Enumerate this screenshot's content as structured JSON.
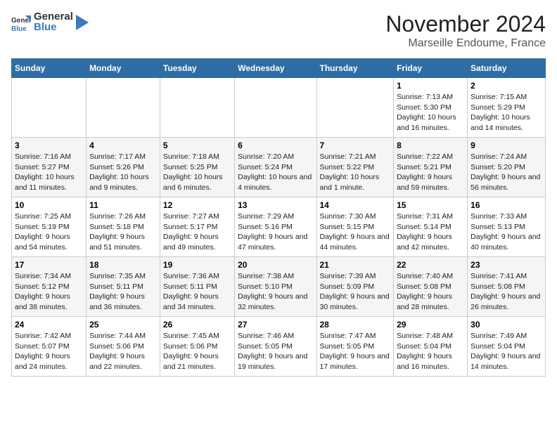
{
  "logo": {
    "text_general": "General",
    "text_blue": "Blue"
  },
  "title": "November 2024",
  "subtitle": "Marseille Endoume, France",
  "days_of_week": [
    "Sunday",
    "Monday",
    "Tuesday",
    "Wednesday",
    "Thursday",
    "Friday",
    "Saturday"
  ],
  "weeks": [
    [
      {
        "day": "",
        "info": ""
      },
      {
        "day": "",
        "info": ""
      },
      {
        "day": "",
        "info": ""
      },
      {
        "day": "",
        "info": ""
      },
      {
        "day": "",
        "info": ""
      },
      {
        "day": "1",
        "info": "Sunrise: 7:13 AM\nSunset: 5:30 PM\nDaylight: 10 hours and 16 minutes."
      },
      {
        "day": "2",
        "info": "Sunrise: 7:15 AM\nSunset: 5:29 PM\nDaylight: 10 hours and 14 minutes."
      }
    ],
    [
      {
        "day": "3",
        "info": "Sunrise: 7:16 AM\nSunset: 5:27 PM\nDaylight: 10 hours and 11 minutes."
      },
      {
        "day": "4",
        "info": "Sunrise: 7:17 AM\nSunset: 5:26 PM\nDaylight: 10 hours and 9 minutes."
      },
      {
        "day": "5",
        "info": "Sunrise: 7:18 AM\nSunset: 5:25 PM\nDaylight: 10 hours and 6 minutes."
      },
      {
        "day": "6",
        "info": "Sunrise: 7:20 AM\nSunset: 5:24 PM\nDaylight: 10 hours and 4 minutes."
      },
      {
        "day": "7",
        "info": "Sunrise: 7:21 AM\nSunset: 5:22 PM\nDaylight: 10 hours and 1 minute."
      },
      {
        "day": "8",
        "info": "Sunrise: 7:22 AM\nSunset: 5:21 PM\nDaylight: 9 hours and 59 minutes."
      },
      {
        "day": "9",
        "info": "Sunrise: 7:24 AM\nSunset: 5:20 PM\nDaylight: 9 hours and 56 minutes."
      }
    ],
    [
      {
        "day": "10",
        "info": "Sunrise: 7:25 AM\nSunset: 5:19 PM\nDaylight: 9 hours and 54 minutes."
      },
      {
        "day": "11",
        "info": "Sunrise: 7:26 AM\nSunset: 5:18 PM\nDaylight: 9 hours and 51 minutes."
      },
      {
        "day": "12",
        "info": "Sunrise: 7:27 AM\nSunset: 5:17 PM\nDaylight: 9 hours and 49 minutes."
      },
      {
        "day": "13",
        "info": "Sunrise: 7:29 AM\nSunset: 5:16 PM\nDaylight: 9 hours and 47 minutes."
      },
      {
        "day": "14",
        "info": "Sunrise: 7:30 AM\nSunset: 5:15 PM\nDaylight: 9 hours and 44 minutes."
      },
      {
        "day": "15",
        "info": "Sunrise: 7:31 AM\nSunset: 5:14 PM\nDaylight: 9 hours and 42 minutes."
      },
      {
        "day": "16",
        "info": "Sunrise: 7:33 AM\nSunset: 5:13 PM\nDaylight: 9 hours and 40 minutes."
      }
    ],
    [
      {
        "day": "17",
        "info": "Sunrise: 7:34 AM\nSunset: 5:12 PM\nDaylight: 9 hours and 38 minutes."
      },
      {
        "day": "18",
        "info": "Sunrise: 7:35 AM\nSunset: 5:11 PM\nDaylight: 9 hours and 36 minutes."
      },
      {
        "day": "19",
        "info": "Sunrise: 7:36 AM\nSunset: 5:11 PM\nDaylight: 9 hours and 34 minutes."
      },
      {
        "day": "20",
        "info": "Sunrise: 7:38 AM\nSunset: 5:10 PM\nDaylight: 9 hours and 32 minutes."
      },
      {
        "day": "21",
        "info": "Sunrise: 7:39 AM\nSunset: 5:09 PM\nDaylight: 9 hours and 30 minutes."
      },
      {
        "day": "22",
        "info": "Sunrise: 7:40 AM\nSunset: 5:08 PM\nDaylight: 9 hours and 28 minutes."
      },
      {
        "day": "23",
        "info": "Sunrise: 7:41 AM\nSunset: 5:08 PM\nDaylight: 9 hours and 26 minutes."
      }
    ],
    [
      {
        "day": "24",
        "info": "Sunrise: 7:42 AM\nSunset: 5:07 PM\nDaylight: 9 hours and 24 minutes."
      },
      {
        "day": "25",
        "info": "Sunrise: 7:44 AM\nSunset: 5:06 PM\nDaylight: 9 hours and 22 minutes."
      },
      {
        "day": "26",
        "info": "Sunrise: 7:45 AM\nSunset: 5:06 PM\nDaylight: 9 hours and 21 minutes."
      },
      {
        "day": "27",
        "info": "Sunrise: 7:46 AM\nSunset: 5:05 PM\nDaylight: 9 hours and 19 minutes."
      },
      {
        "day": "28",
        "info": "Sunrise: 7:47 AM\nSunset: 5:05 PM\nDaylight: 9 hours and 17 minutes."
      },
      {
        "day": "29",
        "info": "Sunrise: 7:48 AM\nSunset: 5:04 PM\nDaylight: 9 hours and 16 minutes."
      },
      {
        "day": "30",
        "info": "Sunrise: 7:49 AM\nSunset: 5:04 PM\nDaylight: 9 hours and 14 minutes."
      }
    ]
  ]
}
